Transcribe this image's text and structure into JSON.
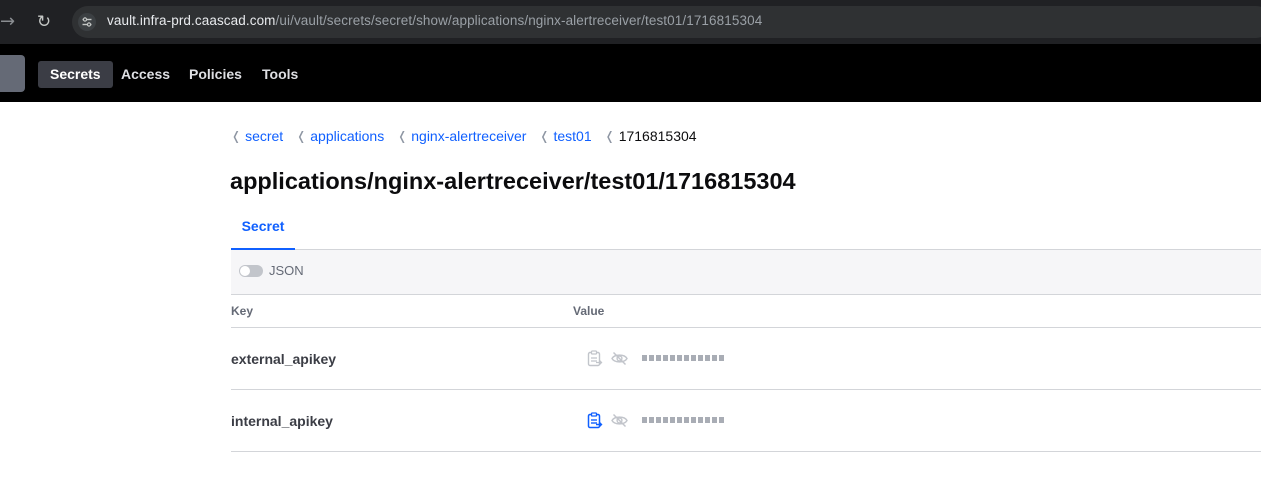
{
  "browser": {
    "url_host": "vault.infra-prd.caascad.com",
    "url_path": "/ui/vault/secrets/secret/show/applications/nginx-alertreceiver/test01/1716815304"
  },
  "nav": {
    "links": [
      "Secrets",
      "Access",
      "Policies",
      "Tools"
    ]
  },
  "breadcrumb": {
    "links": [
      "secret",
      "applications",
      "nginx-alertreceiver",
      "test01"
    ],
    "current": "1716815304"
  },
  "page": {
    "title": "applications/nginx-alertreceiver/test01/1716815304"
  },
  "tabs": [
    "Secret"
  ],
  "toolbar": {
    "json_toggle_label": "JSON"
  },
  "table": {
    "headers": {
      "key": "Key",
      "value": "Value"
    },
    "rows": [
      {
        "key": "external_apikey",
        "copy_active": false
      },
      {
        "key": "internal_apikey",
        "copy_active": true
      }
    ]
  },
  "colors": {
    "accent": "#1060ff",
    "nav_bg": "#000000",
    "chrome_bg": "#202124"
  },
  "icons": [
    "forward-icon",
    "reload-icon",
    "site-info-icon",
    "copy-icon",
    "eye-off-icon"
  ]
}
